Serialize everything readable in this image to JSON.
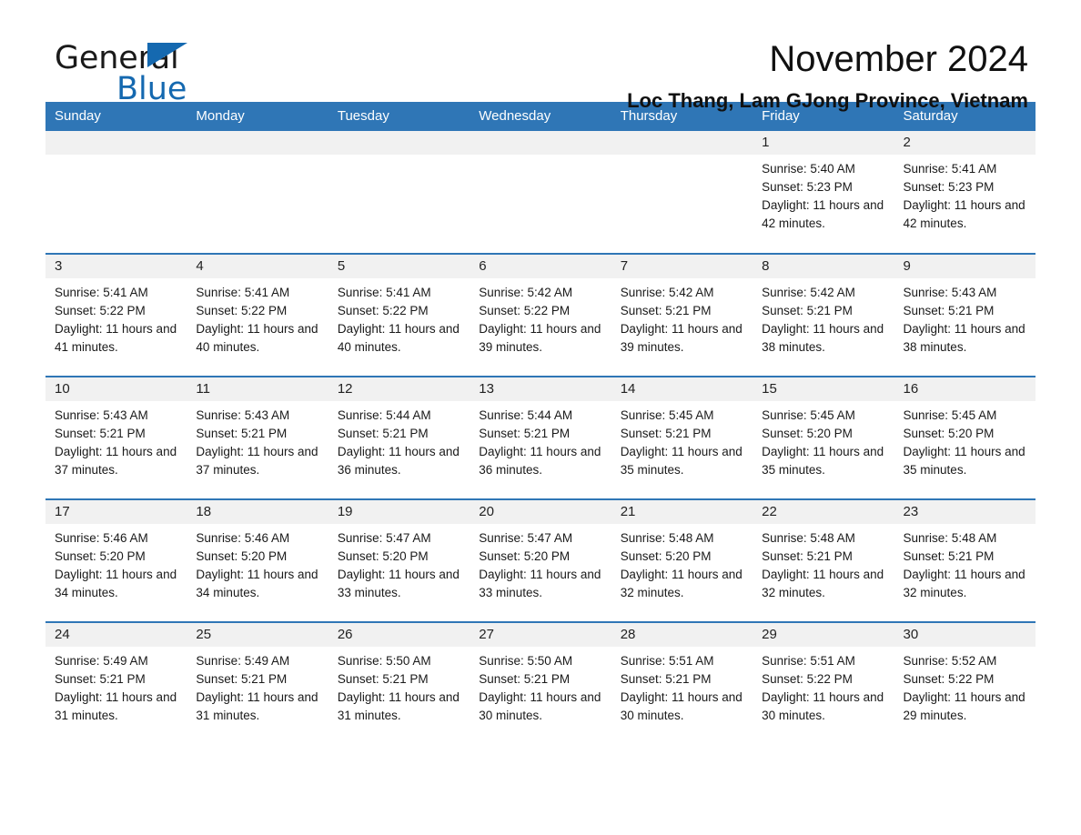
{
  "brand": {
    "name_top": "General",
    "name_bottom": "Blue",
    "triangle_color": "#1569b0"
  },
  "header": {
    "title": "November 2024",
    "subtitle": "Loc Thang, Lam GJong Province, Vietnam"
  },
  "colors": {
    "header_blue": "#2f76b6",
    "daynum_band": "#f1f1f1",
    "text": "#1a1a1a"
  },
  "weekdays": [
    "Sunday",
    "Monday",
    "Tuesday",
    "Wednesday",
    "Thursday",
    "Friday",
    "Saturday"
  ],
  "weeks": [
    [
      {
        "day": "",
        "empty": true
      },
      {
        "day": "",
        "empty": true
      },
      {
        "day": "",
        "empty": true
      },
      {
        "day": "",
        "empty": true
      },
      {
        "day": "",
        "empty": true
      },
      {
        "day": "1",
        "sunrise": "Sunrise: 5:40 AM",
        "sunset": "Sunset: 5:23 PM",
        "daylight": "Daylight: 11 hours and 42 minutes."
      },
      {
        "day": "2",
        "sunrise": "Sunrise: 5:41 AM",
        "sunset": "Sunset: 5:23 PM",
        "daylight": "Daylight: 11 hours and 42 minutes."
      }
    ],
    [
      {
        "day": "3",
        "sunrise": "Sunrise: 5:41 AM",
        "sunset": "Sunset: 5:22 PM",
        "daylight": "Daylight: 11 hours and 41 minutes."
      },
      {
        "day": "4",
        "sunrise": "Sunrise: 5:41 AM",
        "sunset": "Sunset: 5:22 PM",
        "daylight": "Daylight: 11 hours and 40 minutes."
      },
      {
        "day": "5",
        "sunrise": "Sunrise: 5:41 AM",
        "sunset": "Sunset: 5:22 PM",
        "daylight": "Daylight: 11 hours and 40 minutes."
      },
      {
        "day": "6",
        "sunrise": "Sunrise: 5:42 AM",
        "sunset": "Sunset: 5:22 PM",
        "daylight": "Daylight: 11 hours and 39 minutes."
      },
      {
        "day": "7",
        "sunrise": "Sunrise: 5:42 AM",
        "sunset": "Sunset: 5:21 PM",
        "daylight": "Daylight: 11 hours and 39 minutes."
      },
      {
        "day": "8",
        "sunrise": "Sunrise: 5:42 AM",
        "sunset": "Sunset: 5:21 PM",
        "daylight": "Daylight: 11 hours and 38 minutes."
      },
      {
        "day": "9",
        "sunrise": "Sunrise: 5:43 AM",
        "sunset": "Sunset: 5:21 PM",
        "daylight": "Daylight: 11 hours and 38 minutes."
      }
    ],
    [
      {
        "day": "10",
        "sunrise": "Sunrise: 5:43 AM",
        "sunset": "Sunset: 5:21 PM",
        "daylight": "Daylight: 11 hours and 37 minutes."
      },
      {
        "day": "11",
        "sunrise": "Sunrise: 5:43 AM",
        "sunset": "Sunset: 5:21 PM",
        "daylight": "Daylight: 11 hours and 37 minutes."
      },
      {
        "day": "12",
        "sunrise": "Sunrise: 5:44 AM",
        "sunset": "Sunset: 5:21 PM",
        "daylight": "Daylight: 11 hours and 36 minutes."
      },
      {
        "day": "13",
        "sunrise": "Sunrise: 5:44 AM",
        "sunset": "Sunset: 5:21 PM",
        "daylight": "Daylight: 11 hours and 36 minutes."
      },
      {
        "day": "14",
        "sunrise": "Sunrise: 5:45 AM",
        "sunset": "Sunset: 5:21 PM",
        "daylight": "Daylight: 11 hours and 35 minutes."
      },
      {
        "day": "15",
        "sunrise": "Sunrise: 5:45 AM",
        "sunset": "Sunset: 5:20 PM",
        "daylight": "Daylight: 11 hours and 35 minutes."
      },
      {
        "day": "16",
        "sunrise": "Sunrise: 5:45 AM",
        "sunset": "Sunset: 5:20 PM",
        "daylight": "Daylight: 11 hours and 35 minutes."
      }
    ],
    [
      {
        "day": "17",
        "sunrise": "Sunrise: 5:46 AM",
        "sunset": "Sunset: 5:20 PM",
        "daylight": "Daylight: 11 hours and 34 minutes."
      },
      {
        "day": "18",
        "sunrise": "Sunrise: 5:46 AM",
        "sunset": "Sunset: 5:20 PM",
        "daylight": "Daylight: 11 hours and 34 minutes."
      },
      {
        "day": "19",
        "sunrise": "Sunrise: 5:47 AM",
        "sunset": "Sunset: 5:20 PM",
        "daylight": "Daylight: 11 hours and 33 minutes."
      },
      {
        "day": "20",
        "sunrise": "Sunrise: 5:47 AM",
        "sunset": "Sunset: 5:20 PM",
        "daylight": "Daylight: 11 hours and 33 minutes."
      },
      {
        "day": "21",
        "sunrise": "Sunrise: 5:48 AM",
        "sunset": "Sunset: 5:20 PM",
        "daylight": "Daylight: 11 hours and 32 minutes."
      },
      {
        "day": "22",
        "sunrise": "Sunrise: 5:48 AM",
        "sunset": "Sunset: 5:21 PM",
        "daylight": "Daylight: 11 hours and 32 minutes."
      },
      {
        "day": "23",
        "sunrise": "Sunrise: 5:48 AM",
        "sunset": "Sunset: 5:21 PM",
        "daylight": "Daylight: 11 hours and 32 minutes."
      }
    ],
    [
      {
        "day": "24",
        "sunrise": "Sunrise: 5:49 AM",
        "sunset": "Sunset: 5:21 PM",
        "daylight": "Daylight: 11 hours and 31 minutes."
      },
      {
        "day": "25",
        "sunrise": "Sunrise: 5:49 AM",
        "sunset": "Sunset: 5:21 PM",
        "daylight": "Daylight: 11 hours and 31 minutes."
      },
      {
        "day": "26",
        "sunrise": "Sunrise: 5:50 AM",
        "sunset": "Sunset: 5:21 PM",
        "daylight": "Daylight: 11 hours and 31 minutes."
      },
      {
        "day": "27",
        "sunrise": "Sunrise: 5:50 AM",
        "sunset": "Sunset: 5:21 PM",
        "daylight": "Daylight: 11 hours and 30 minutes."
      },
      {
        "day": "28",
        "sunrise": "Sunrise: 5:51 AM",
        "sunset": "Sunset: 5:21 PM",
        "daylight": "Daylight: 11 hours and 30 minutes."
      },
      {
        "day": "29",
        "sunrise": "Sunrise: 5:51 AM",
        "sunset": "Sunset: 5:22 PM",
        "daylight": "Daylight: 11 hours and 30 minutes."
      },
      {
        "day": "30",
        "sunrise": "Sunrise: 5:52 AM",
        "sunset": "Sunset: 5:22 PM",
        "daylight": "Daylight: 11 hours and 29 minutes."
      }
    ]
  ]
}
